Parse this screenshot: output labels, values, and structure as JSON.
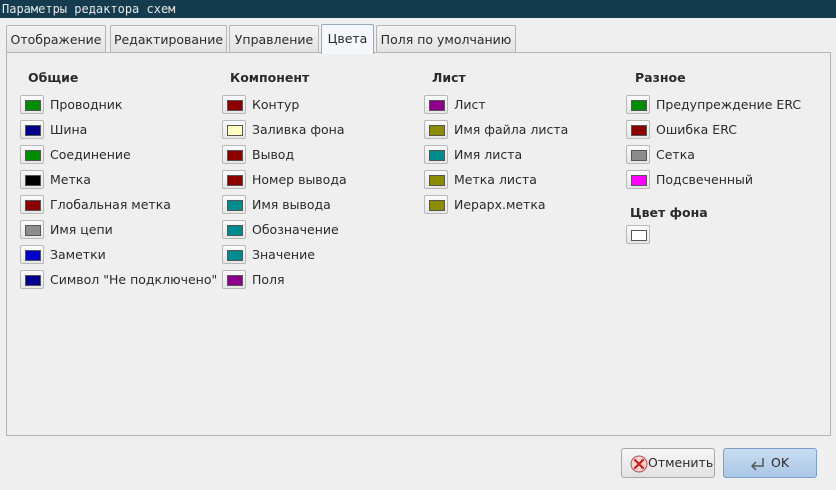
{
  "window": {
    "title": "Параметры редактора схем"
  },
  "tabs": [
    {
      "label": "Отображение"
    },
    {
      "label": "Редактирование"
    },
    {
      "label": "Управление"
    },
    {
      "label": "Цвета",
      "active": true
    },
    {
      "label": "Поля по умолчанию"
    }
  ],
  "groups": {
    "general": {
      "title": "Общие",
      "items": [
        {
          "label": "Проводник",
          "color": "#008c00"
        },
        {
          "label": "Шина",
          "color": "#00008c"
        },
        {
          "label": "Соединение",
          "color": "#008c00"
        },
        {
          "label": "Метка",
          "color": "#000000"
        },
        {
          "label": "Глобальная метка",
          "color": "#8c0000"
        },
        {
          "label": "Имя цепи",
          "color": "#8c8c8c"
        },
        {
          "label": "Заметки",
          "color": "#0000c8"
        },
        {
          "label": "Символ \"Не подключено\"",
          "color": "#00008c"
        }
      ]
    },
    "component": {
      "title": "Компонент",
      "items": [
        {
          "label": "Контур",
          "color": "#8c0000"
        },
        {
          "label": "Заливка фона",
          "color": "#ffffc2"
        },
        {
          "label": "Вывод",
          "color": "#8c0000"
        },
        {
          "label": "Номер вывода",
          "color": "#8c0000"
        },
        {
          "label": "Имя вывода",
          "color": "#008c8c"
        },
        {
          "label": "Обозначение",
          "color": "#008c8c"
        },
        {
          "label": "Значение",
          "color": "#008c8c"
        },
        {
          "label": "Поля",
          "color": "#8c008c"
        }
      ]
    },
    "sheet": {
      "title": "Лист",
      "items": [
        {
          "label": "Лист",
          "color": "#8c008c"
        },
        {
          "label": "Имя файла листа",
          "color": "#8c8c00"
        },
        {
          "label": "Имя листа",
          "color": "#008c8c"
        },
        {
          "label": "Метка листа",
          "color": "#8c8c00"
        },
        {
          "label": "Иерарх.метка",
          "color": "#8c8c00"
        }
      ]
    },
    "misc": {
      "title": "Разное",
      "items": [
        {
          "label": "Предупреждение ERC",
          "color": "#008c00"
        },
        {
          "label": "Ошибка ERC",
          "color": "#8c0000"
        },
        {
          "label": "Сетка",
          "color": "#8c8c8c"
        },
        {
          "label": "Подсвеченный",
          "color": "#ff00ff"
        }
      ],
      "background_title": "Цвет фона",
      "background_color": "#ffffff"
    }
  },
  "buttons": {
    "cancel_label": "Отменить",
    "ok_label": "OK"
  }
}
